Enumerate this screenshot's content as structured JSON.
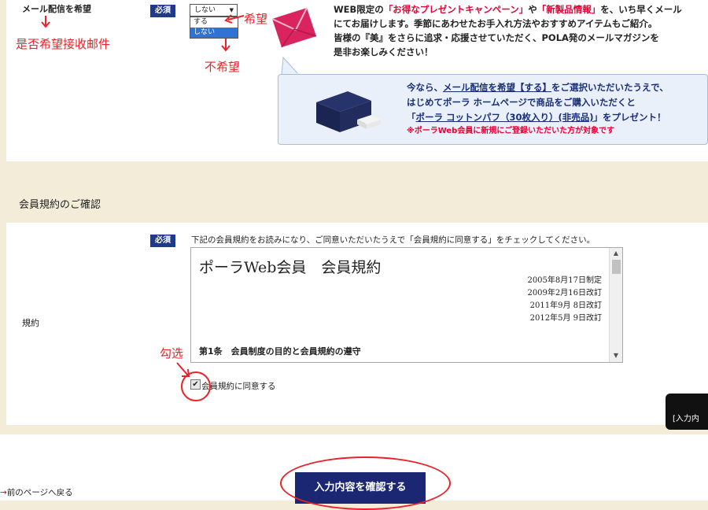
{
  "mail_section": {
    "label": "メール配信を希望",
    "required": "必須",
    "select_value": "しない",
    "options": [
      "する",
      "しない"
    ],
    "desc_line1_a": "WEB限定の",
    "desc_line1_b": "「お得なプレゼントキャンペーン」",
    "desc_line1_c": "や",
    "desc_line1_d": "「新製品情報」",
    "desc_line1_e": "を、いち早くメール",
    "desc_line2": "にてお届けします。季節にあわせたお手入れ方法やおすすめアイテムもご紹介。",
    "desc_line3": "皆様の『美』をさらに追求・応援させていただく、POLA発のメールマガジンを",
    "desc_line4": "是非お楽しみください！",
    "promo_line1_a": "今なら、",
    "promo_line1_b": "メール配信を希望【する】",
    "promo_line1_c": "をご選択いただいたうえで、",
    "promo_line2": "はじめてポーラ ホームページで商品をご購入いただくと",
    "promo_line3_a": "「",
    "promo_line3_b": "ポーラ コットンパフ（30枚入り）(非売品)",
    "promo_line3_c": "」をプレゼント！",
    "promo_note": "※ポーラWeb会員に新規にご登録いただいた方が対象です"
  },
  "annotations": {
    "whether_receive": "是否希望接收邮件",
    "want": "希望",
    "not_want": "不希望",
    "check": "勾选"
  },
  "terms_section": {
    "title": "会員規約のご確認",
    "required": "必須",
    "row_label": "規約",
    "instruction": "下記の会員規約をお読みになり、ご同意いただいたうえで「会員規約に同意する」をチェックしてください。",
    "doc_title": "ポーラWeb会員　会員規約",
    "dates": [
      "2005年8月17日制定",
      "2009年2月16日改訂",
      "2011年9月 8日改訂",
      "2012年5月 9日改訂"
    ],
    "article1": "第1条　会員制度の目的と会員規約の遵守",
    "agree_label": "会員規約に同意する",
    "agree_checked": true
  },
  "footer": {
    "back_link": "前のページへ戻る",
    "confirm_button": "入力内容を確認する",
    "side_tab": "[入力内"
  }
}
